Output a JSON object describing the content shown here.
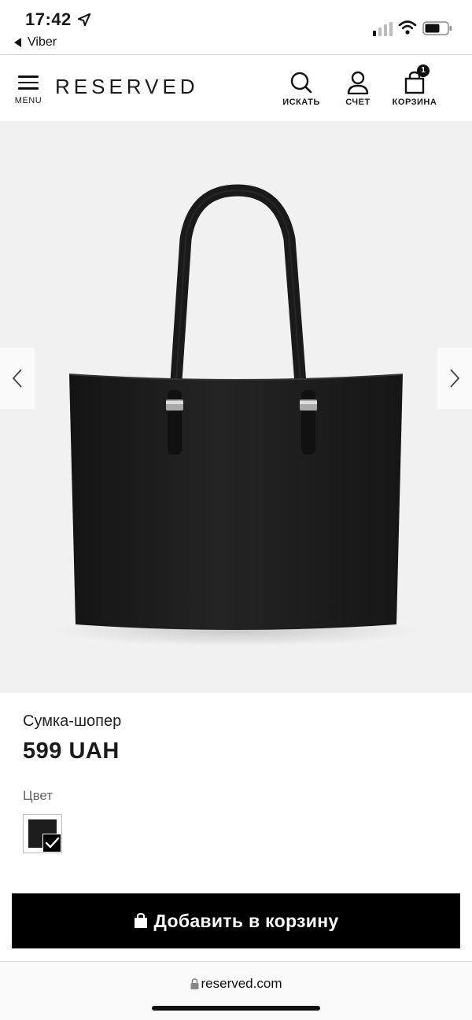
{
  "status_bar": {
    "time": "17:42",
    "back_app": "Viber",
    "location_icon": "location-arrow-icon",
    "signal_icon": "cellular-signal-icon",
    "wifi_icon": "wifi-icon",
    "battery_icon": "battery-icon"
  },
  "header": {
    "menu_label": "MENU",
    "logo": "RESERVED",
    "search_label": "ИСКАТЬ",
    "account_label": "СЧЕТ",
    "cart_label": "КОРЗИНА",
    "cart_count": "1"
  },
  "product": {
    "name": "Сумка-шопер",
    "price": "599 UAH",
    "color_label": "Цвет",
    "swatch_color": "#1d1d1d",
    "swatch_selected": true
  },
  "actions": {
    "add_to_cart": "Добавить в корзину"
  },
  "browser": {
    "url": "reserved.com"
  }
}
